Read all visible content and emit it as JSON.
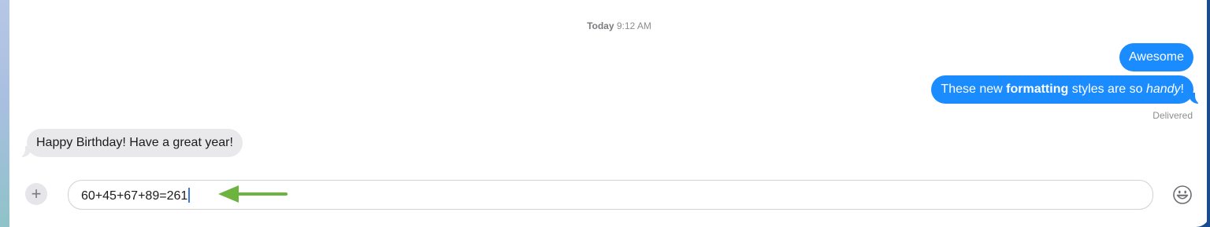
{
  "conversation": {
    "timestamp_day": "Today",
    "timestamp_time": "9:12 AM",
    "sent": [
      {
        "segments": [
          {
            "text": "Awesome",
            "style": "normal"
          }
        ]
      },
      {
        "segments": [
          {
            "text": "These new ",
            "style": "normal"
          },
          {
            "text": "formatting",
            "style": "bold"
          },
          {
            "text": " styles are so ",
            "style": "normal"
          },
          {
            "text": "handy",
            "style": "italic"
          },
          {
            "text": "!",
            "style": "normal"
          }
        ]
      }
    ],
    "delivered_label": "Delivered",
    "received": [
      {
        "text": "Happy Birthday! Have a great year!"
      }
    ]
  },
  "composer": {
    "input_value": "60+45+67+89=261",
    "plus_label": "+",
    "emoji_icon": "emoji-smiley-icon",
    "annotation_icon": "green-arrow-icon",
    "annotation_color": "#6db33f"
  },
  "colors": {
    "sent_bubble": "#1a8cff",
    "received_bubble": "#e9e9eb",
    "secondary_text": "#8e8e93"
  }
}
